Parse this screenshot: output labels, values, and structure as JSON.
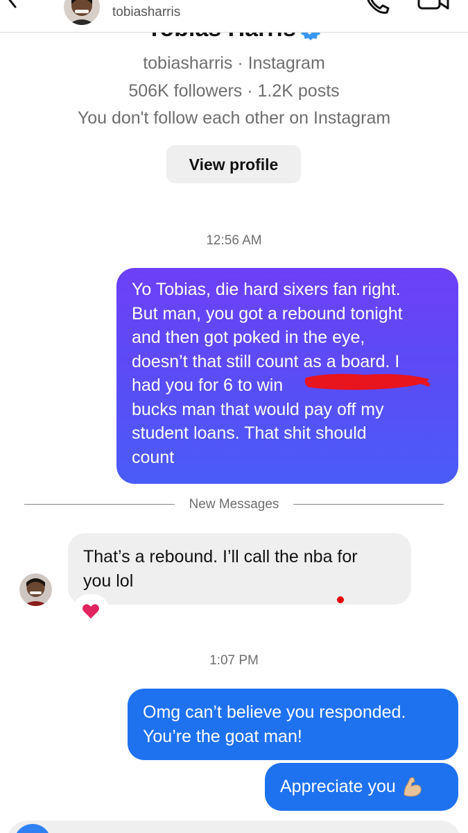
{
  "header": {
    "username": "tobiasharris"
  },
  "profile": {
    "display_name": "Tobias Harris",
    "handle_line": "tobiasharris · Instagram",
    "stats_line": "506K followers · 1.2K posts",
    "relationship_line": "You don't follow each other on Instagram",
    "view_profile_label": "View profile"
  },
  "thread": {
    "timestamp_1": "12:56 AM",
    "sent_message_1": "Yo Tobias, die hard sixers fan right.\nBut man, you got a rebound tonight\nand then got poked in the eye,\ndoesn’t that still count as a board. I\nhad you for 6 to win\nbucks man that would pay off my\nstudent loans. That shit should\ncount",
    "divider_label": "New Messages",
    "received_message_1": "That’s a rebound. I’ll call the nba for\nyou lol",
    "reaction_icon": "red-heart",
    "timestamp_2": "1:07 PM",
    "sent_message_2": "Omg can’t believe you responded.\nYou’re the goat man!",
    "sent_message_3": "Appreciate you",
    "sent_message_3_emoji": "flexed-biceps"
  },
  "colors": {
    "sent_gradient_top": "#6d40f7",
    "sent_gradient_bottom": "#4a5cf8",
    "sent_blue": "#1f72ef",
    "received_bg": "#efefef",
    "heart": "#e0245e",
    "redaction": "#e8141e",
    "verified_badge": "#3897f0"
  }
}
